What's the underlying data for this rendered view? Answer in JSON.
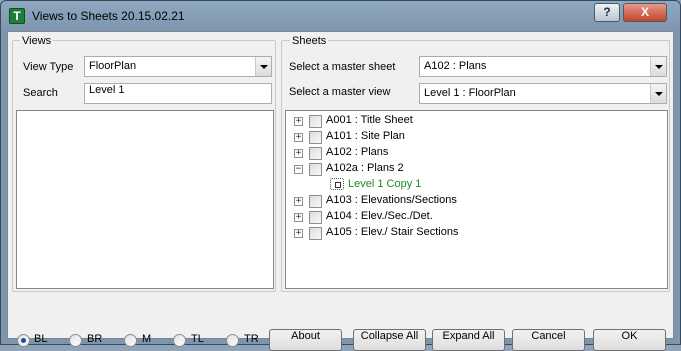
{
  "window": {
    "title": "Views to Sheets 20.15.02.21",
    "icon_glyph": "T",
    "help_label": "?",
    "close_label": "X"
  },
  "views": {
    "group_label": "Views",
    "view_type_label": "View Type",
    "view_type_value": "FloorPlan",
    "search_label": "Search",
    "search_value": "Level 1"
  },
  "sheets": {
    "group_label": "Sheets",
    "master_sheet_label": "Select a master sheet",
    "master_sheet_value": "A102 : Plans",
    "master_view_label": "Select a master view",
    "master_view_value": "Level 1 : FloorPlan",
    "tree": [
      {
        "label": "A001 : Title Sheet",
        "expander": "+"
      },
      {
        "label": "A101 : Site Plan",
        "expander": "+"
      },
      {
        "label": "A102 : Plans",
        "expander": "+"
      },
      {
        "label": "A102a : Plans 2",
        "expander": "−"
      },
      {
        "label": "Level 1 Copy 1",
        "child": true
      },
      {
        "label": "A103 : Elevations/Sections",
        "expander": "+"
      },
      {
        "label": "A104 : Elev./Sec./Det.",
        "expander": "+"
      },
      {
        "label": "A105 : Elev./ Stair Sections",
        "expander": "+"
      }
    ]
  },
  "alignment": {
    "options": [
      "BL",
      "BR",
      "M",
      "TL",
      "TR"
    ],
    "selected": "BL"
  },
  "buttons": {
    "about": "About",
    "collapse_all": "Collapse All",
    "expand_all": "Expand All",
    "cancel": "Cancel",
    "ok": "OK"
  },
  "colors": {
    "child_view_text": "#1f8a1f",
    "close_button": "#c2442b"
  }
}
